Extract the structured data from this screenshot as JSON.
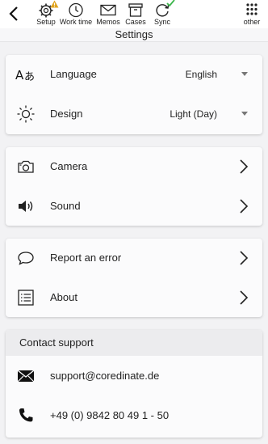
{
  "toolbar": {
    "items": [
      {
        "label": "Setup",
        "icon": "gear-icon",
        "badge": "warning-icon",
        "badge_color": "#e0a21a"
      },
      {
        "label": "Work time",
        "icon": "clock-icon"
      },
      {
        "label": "Memos",
        "icon": "envelope-icon"
      },
      {
        "label": "Cases",
        "icon": "archive-box-icon"
      },
      {
        "label": "Sync",
        "icon": "sync-icon",
        "badge": "check-icon",
        "badge_color": "#3bb54a"
      },
      {
        "label": "other",
        "icon": "grid-dots-icon"
      }
    ]
  },
  "page": {
    "title": "Settings"
  },
  "settings": {
    "language": {
      "label": "Language",
      "value": "English",
      "icon": "language-icon"
    },
    "design": {
      "label": "Design",
      "value": "Light (Day)",
      "icon": "sun-icon"
    },
    "camera": {
      "label": "Camera",
      "icon": "camera-icon"
    },
    "sound": {
      "label": "Sound",
      "icon": "speaker-icon"
    },
    "report": {
      "label": "Report an error",
      "icon": "speech-bubble-icon"
    },
    "about": {
      "label": "About",
      "icon": "list-icon"
    }
  },
  "support": {
    "heading": "Contact support",
    "email": "support@coredinate.de",
    "phone": "+49 (0) 9842 80 49 1 - 50"
  }
}
